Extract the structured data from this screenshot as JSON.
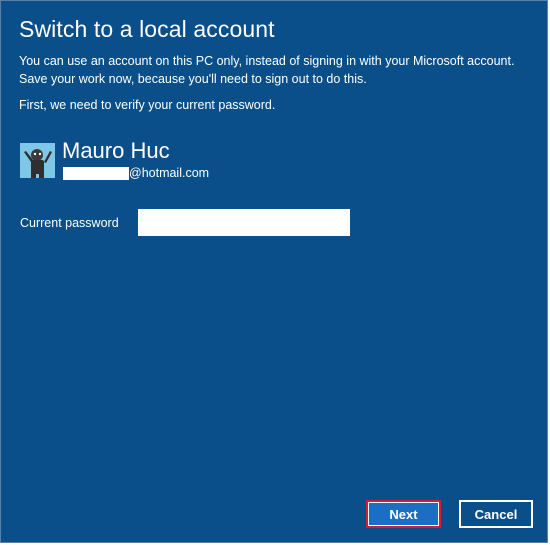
{
  "dialog": {
    "title": "Switch to a local account",
    "description": "You can use an account on this PC only, instead of signing in with your Microsoft account. Save your work now, because you'll need to sign out to do this.",
    "verify_text": "First, we need to verify your current password."
  },
  "user": {
    "name": "Mauro Huc",
    "email_suffix": "@hotmail.com",
    "avatar_icon": "user-avatar-icon"
  },
  "form": {
    "password_label": "Current password",
    "password_value": ""
  },
  "buttons": {
    "next_label": "Next",
    "cancel_label": "Cancel"
  },
  "colors": {
    "background": "#0b4f8a",
    "next_button": "#1b6ec2",
    "highlight_border": "#d21c3a"
  }
}
